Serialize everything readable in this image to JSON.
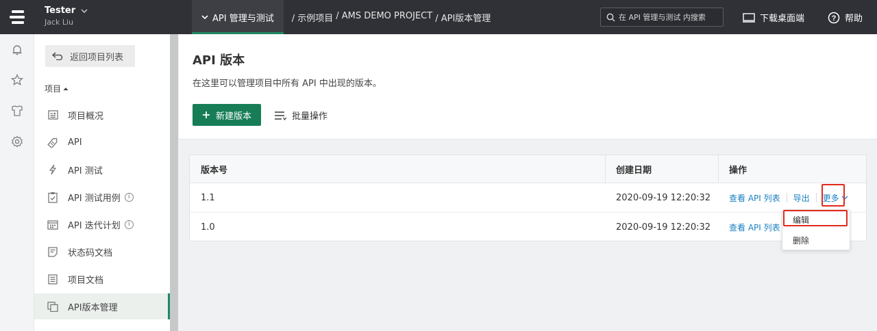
{
  "topbar": {
    "user_name": "Tester",
    "user_sub": "Jack Liu",
    "module_label": "API 管理与测试",
    "breadcrumbs": [
      "/ 示例项目",
      "/ AMS DEMO PROJECT",
      "/ API版本管理"
    ],
    "search_placeholder": "在 API 管理与测试 内搜索",
    "download_label": "下载桌面端",
    "help_label": "帮助"
  },
  "rail": {
    "icons": [
      "bell-icon",
      "star-icon",
      "shirt-icon",
      "gear-icon"
    ]
  },
  "sidenav": {
    "back_label": "返回项目列表",
    "section_label": "项目",
    "items": [
      {
        "label": "项目概况",
        "icon": "overview-icon",
        "info": false,
        "active": false
      },
      {
        "label": "API",
        "icon": "api-tag-icon",
        "info": false,
        "active": false
      },
      {
        "label": "API 测试",
        "icon": "lightning-icon",
        "info": false,
        "active": false
      },
      {
        "label": "API 测试用例",
        "icon": "clipboard-check-icon",
        "info": true,
        "active": false
      },
      {
        "label": "API 迭代计划",
        "icon": "calendar-icon",
        "info": true,
        "active": false
      },
      {
        "label": "状态码文档",
        "icon": "note-icon",
        "info": false,
        "active": false
      },
      {
        "label": "项目文档",
        "icon": "document-icon",
        "info": false,
        "active": false
      },
      {
        "label": "API版本管理",
        "icon": "versions-icon",
        "info": false,
        "active": true
      }
    ]
  },
  "main": {
    "title": "API 版本",
    "description": "在这里可以管理项目中所有 API 中出现的版本。",
    "new_button": "新建版本",
    "batch_label": "批量操作"
  },
  "table": {
    "columns": [
      "版本号",
      "创建日期",
      "操作"
    ],
    "rows": [
      {
        "version": "1.1",
        "created": "2020-09-19 12:20:32"
      },
      {
        "version": "1.0",
        "created": "2020-09-19 12:20:32"
      }
    ],
    "actions": {
      "view": "查看 API 列表",
      "export": "导出",
      "more": "更多"
    }
  },
  "dropdown": {
    "items": [
      "编辑",
      "删除"
    ]
  },
  "colors": {
    "accent": "#167d57",
    "link": "#1a7fc2",
    "highlight": "#e0291c"
  }
}
